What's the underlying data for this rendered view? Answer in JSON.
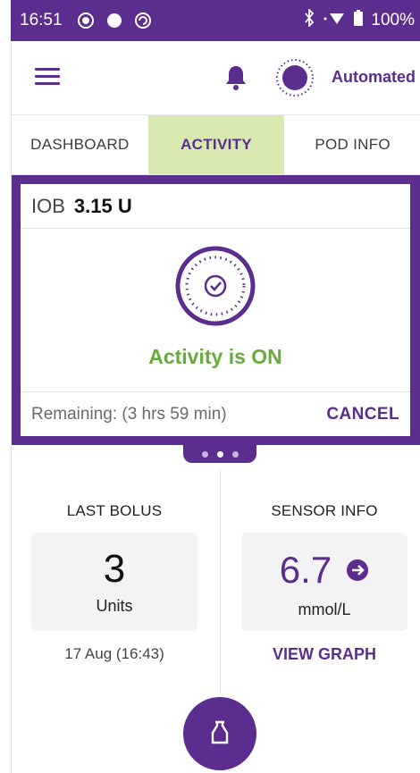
{
  "status_bar": {
    "time": "16:51",
    "battery": "100%",
    "icons": [
      "dot-circle-icon",
      "circle-icon",
      "sync-icon",
      "bluetooth-icon",
      "wifi-icon",
      "battery-icon"
    ]
  },
  "header": {
    "menu_icon": "hamburger-menu-icon",
    "notification_icon": "bell-icon",
    "mode_icon": "automated-mode-icon",
    "mode_label": "Automated"
  },
  "tabs": [
    {
      "label": "DASHBOARD",
      "active": false
    },
    {
      "label": "ACTIVITY",
      "active": true
    },
    {
      "label": "POD INFO",
      "active": false
    }
  ],
  "activity_card": {
    "iob_label": "IOB",
    "iob_value": "3.15 U",
    "status_icon": "activity-check-icon",
    "status_text": "Activity is ON",
    "remaining_text": "Remaining: (3 hrs 59 min)",
    "cancel_label": "CANCEL"
  },
  "pager": {
    "count": 3,
    "current": 1
  },
  "last_bolus": {
    "title": "LAST BOLUS",
    "value": "3",
    "unit": "Units",
    "date": "17 Aug (16:43)"
  },
  "sensor_info": {
    "title": "SENSOR INFO",
    "value": "6.7",
    "trend_icon": "arrow-right-circle-icon",
    "unit": "mmol/L",
    "view_graph_label": "VIEW GRAPH"
  },
  "fab": {
    "icon": "bolus-vial-icon"
  },
  "colors": {
    "brand_purple": "#5b2d8e",
    "active_tab_bg": "#d7e8b1",
    "status_green": "#65ad3b",
    "tile_bg": "#f3f3f5"
  }
}
